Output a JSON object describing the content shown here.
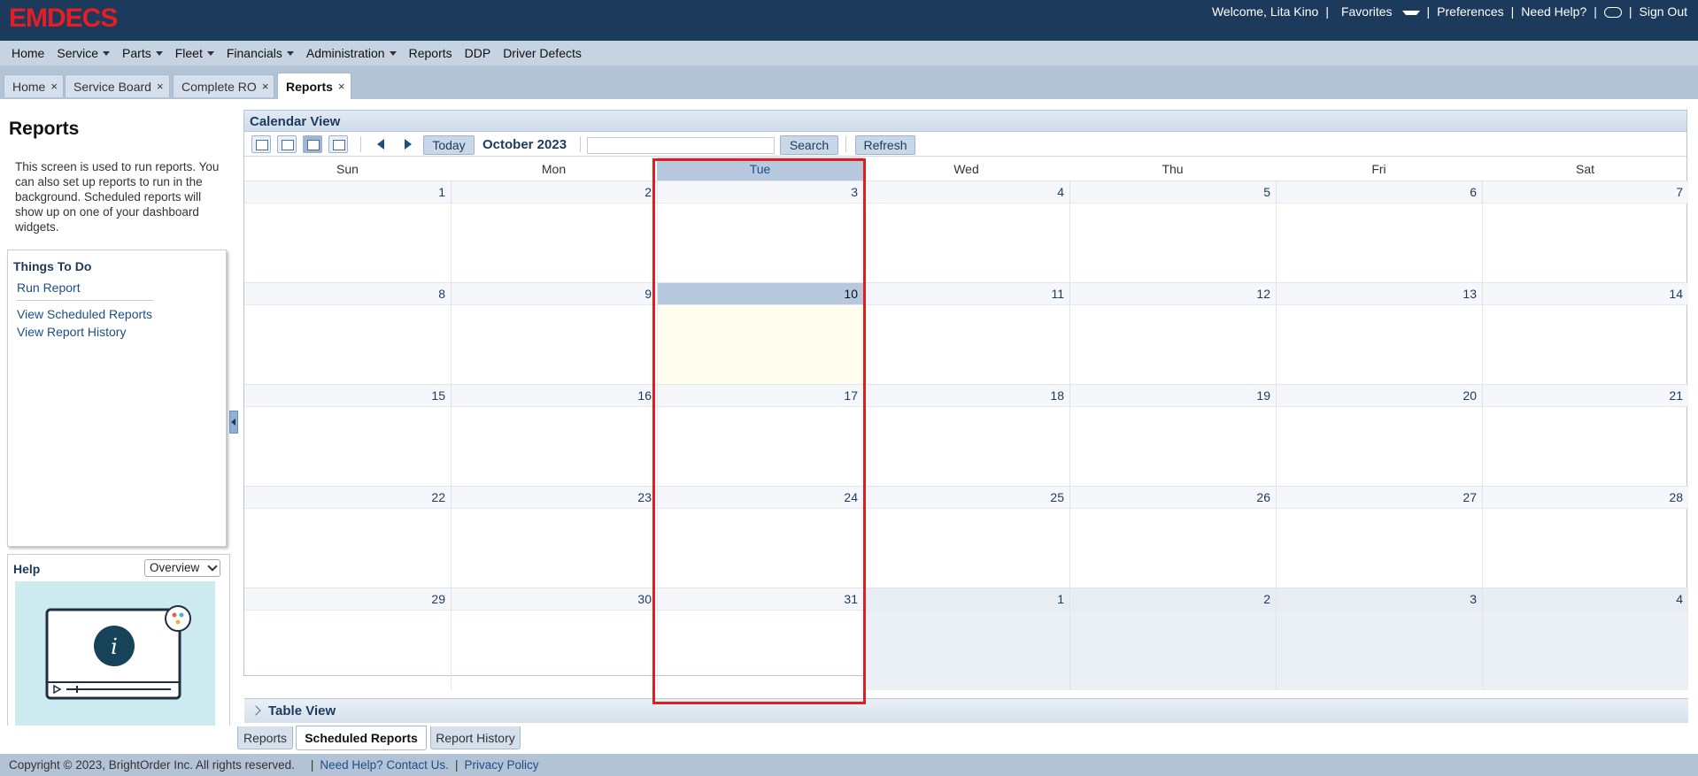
{
  "app": {
    "logo_text": "EMDECS"
  },
  "top_links": {
    "welcome": "Welcome, Lita Kino",
    "favorites": "Favorites",
    "preferences": "Preferences",
    "need_help": "Need Help?",
    "sign_out": "Sign Out",
    "separator": "|"
  },
  "menu": {
    "items": [
      {
        "label": "Home",
        "dropdown": false
      },
      {
        "label": "Service",
        "dropdown": true
      },
      {
        "label": "Parts",
        "dropdown": true
      },
      {
        "label": "Fleet",
        "dropdown": true
      },
      {
        "label": "Financials",
        "dropdown": true
      },
      {
        "label": "Administration",
        "dropdown": true
      },
      {
        "label": "Reports",
        "dropdown": false
      },
      {
        "label": "DDP",
        "dropdown": false
      },
      {
        "label": "Driver Defects",
        "dropdown": false
      }
    ]
  },
  "tabs": [
    {
      "label": "Home",
      "active": false
    },
    {
      "label": "Service Board",
      "active": false
    },
    {
      "label": "Complete RO",
      "active": false
    },
    {
      "label": "Reports",
      "active": true
    }
  ],
  "tab_close": "×",
  "left_panel": {
    "title": "Reports",
    "description": "This screen is used to run reports. You can also set up reports to run in the background. Scheduled reports will show up on one of your dashboard widgets.",
    "todo_title": "Things To Do",
    "todo_links": [
      "Run Report",
      "View Scheduled Reports",
      "View Report History"
    ],
    "help_title": "Help",
    "help_select_value": "Overview"
  },
  "calendar": {
    "panel_title": "Calendar View",
    "today_button": "Today",
    "month_label": "October 2023",
    "search_button": "Search",
    "refresh_button": "Refresh",
    "search_value": "",
    "days_of_week": [
      "Sun",
      "Mon",
      "Tue",
      "Wed",
      "Thu",
      "Fri",
      "Sat"
    ],
    "highlighted_dow": "Tue",
    "today_date": "10",
    "weeks": [
      [
        "1",
        "2",
        "3",
        "4",
        "5",
        "6",
        "7"
      ],
      [
        "8",
        "9",
        "10",
        "11",
        "12",
        "13",
        "14"
      ],
      [
        "15",
        "16",
        "17",
        "18",
        "19",
        "20",
        "21"
      ],
      [
        "22",
        "23",
        "24",
        "25",
        "26",
        "27",
        "28"
      ],
      [
        "29",
        "30",
        "31",
        "1",
        "2",
        "3",
        "4"
      ]
    ],
    "table_view_label": "Table View"
  },
  "bottom_tabs": [
    {
      "label": "Reports",
      "active": false
    },
    {
      "label": "Scheduled Reports",
      "active": true
    },
    {
      "label": "Report History",
      "active": false
    }
  ],
  "footer": {
    "copyright": "Copyright © 2023, BrightOrder Inc. All rights reserved.",
    "help_link": "Need Help? Contact Us.",
    "privacy_link": "Privacy Policy",
    "separator": "|"
  },
  "colors": {
    "header_bg": "#1c3a5c",
    "logo": "#e31e24",
    "highlight_border": "#e21d1d",
    "today_fill": "#fffdee"
  }
}
